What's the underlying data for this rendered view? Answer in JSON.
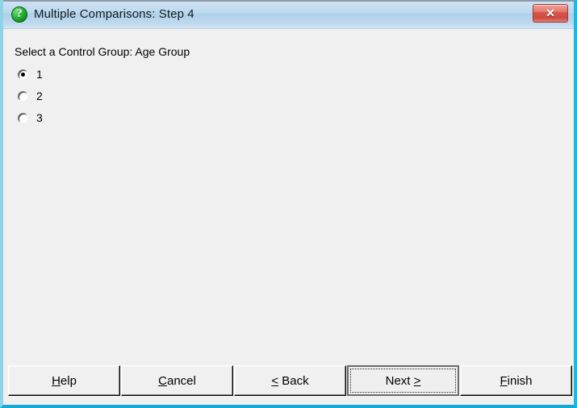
{
  "window": {
    "title": "Multiple Comparisons: Step 4",
    "icon": "question-help-icon",
    "close_label": "✕",
    "frame_color": "#22b5dd",
    "titlebar_color": "#bcd8ee",
    "client_color": "#f0f0f0"
  },
  "content": {
    "group_label": "Select a Control Group: Age Group",
    "radios": [
      {
        "label": "1",
        "checked": true
      },
      {
        "label": "2",
        "checked": false
      },
      {
        "label": "3",
        "checked": false
      }
    ]
  },
  "buttons": {
    "help": {
      "prefix": "",
      "accel": "H",
      "suffix": "elp"
    },
    "cancel": {
      "prefix": "",
      "accel": "C",
      "suffix": "ancel"
    },
    "back": {
      "prefix": "",
      "accel": "<",
      "suffix": " Back"
    },
    "next": {
      "prefix": "Next ",
      "accel": ">",
      "suffix": ""
    },
    "finish": {
      "prefix": "",
      "accel": "F",
      "suffix": "inish"
    },
    "default_button": "next"
  }
}
